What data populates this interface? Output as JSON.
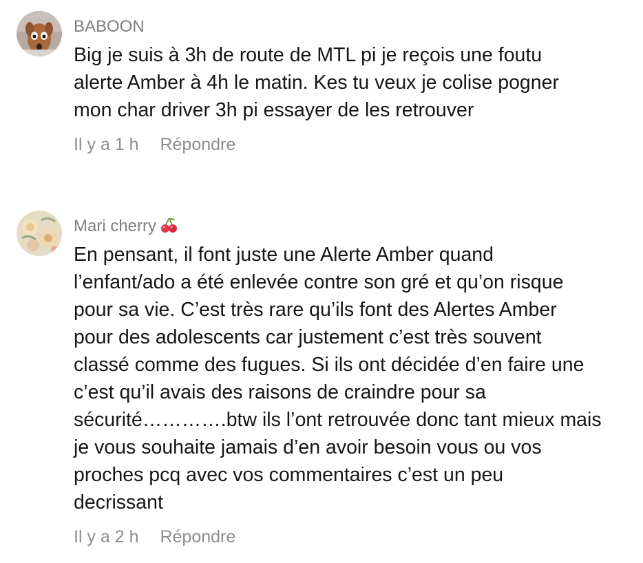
{
  "comments": [
    {
      "username": "BABOON",
      "text_lines": [
        "Big je suis à 3h de route de MTL pi je reçois une foutu",
        "alerte Amber à 4h le matin. Kes tu veux je colise pogner",
        "mon char driver 3h pi essayer de les retrouver"
      ],
      "time": "Il y a 1 h",
      "reply_label": "Répondre",
      "avatar_icon": "dog-photo-avatar"
    },
    {
      "username": "Mari cherry",
      "username_emoji": "cherry-icon",
      "text_lines": [
        "En pensant, il font juste une Alerte Amber quand",
        "l’enfant/ado a été enlevée contre son gré et qu’on risque",
        "pour sa vie. C’est très rare qu’ils font des Alertes Amber",
        "pour des adolescents car justement c’est très souvent",
        "classé comme des fugues. Si ils ont décidée d’en faire une",
        "c’est qu’il avais des raisons de craindre pour sa",
        "sécurité………….btw ils l’ont retrouvée donc tant mieux mais",
        "je vous souhaite jamais d’en avoir besoin vous ou vos",
        "proches pcq avec vos commentaires c’est un peu",
        "decrissant"
      ],
      "time": "Il y a 2 h",
      "reply_label": "Répondre",
      "avatar_icon": "floral-photo-avatar"
    }
  ]
}
